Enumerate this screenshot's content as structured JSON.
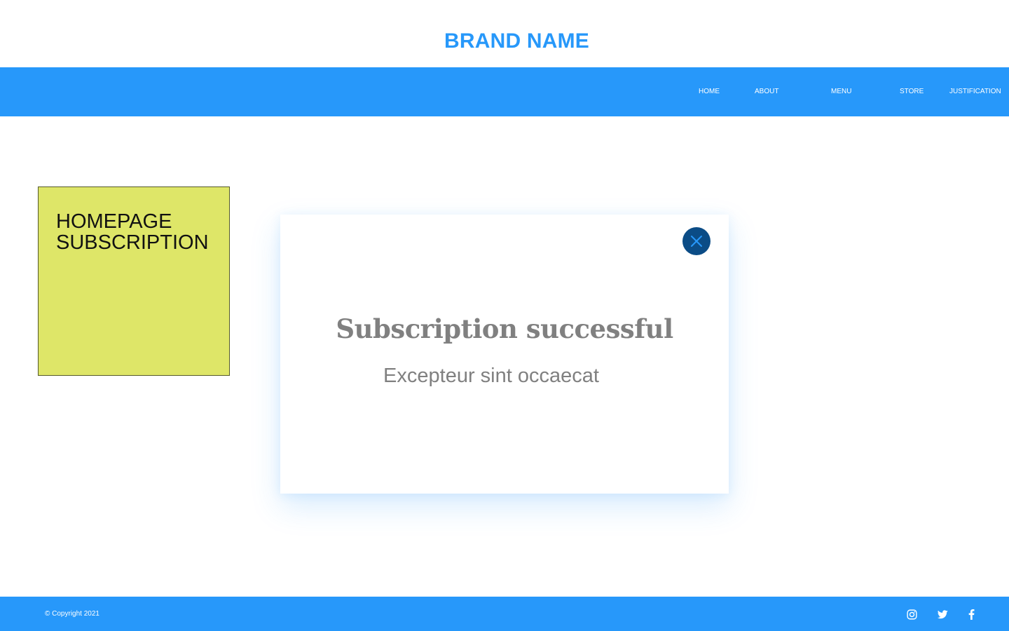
{
  "header": {
    "brand_name": "BRAND NAME"
  },
  "nav": {
    "items": [
      {
        "label": "HOME"
      },
      {
        "label": "ABOUT"
      },
      {
        "label": "MENU"
      },
      {
        "label": "STORE"
      },
      {
        "label": "JUSTIFICATION"
      }
    ]
  },
  "card": {
    "title": "HOMEPAGE\nSUBSCRIPTION"
  },
  "modal": {
    "title": "Subscription successful",
    "text": "Excepteur sint occaecat",
    "close_icon": "close-icon"
  },
  "footer": {
    "copyright": "© Copyright 2021",
    "social_icons": [
      "instagram-icon",
      "twitter-icon",
      "facebook-icon"
    ]
  },
  "colors": {
    "brand_blue": "#2798FA",
    "card_yellow": "#DEE668",
    "close_button_bg": "#0B4C86",
    "close_icon": "#2798FA",
    "modal_text_gray": "#808080"
  }
}
